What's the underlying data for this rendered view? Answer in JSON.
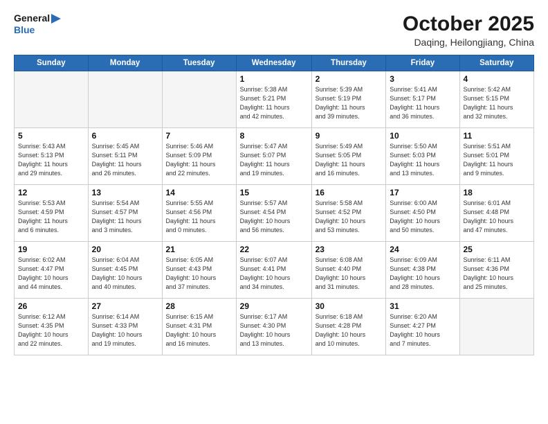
{
  "logo": {
    "line1": "General",
    "line2": "Blue"
  },
  "title": "October 2025",
  "location": "Daqing, Heilongjiang, China",
  "weekdays": [
    "Sunday",
    "Monday",
    "Tuesday",
    "Wednesday",
    "Thursday",
    "Friday",
    "Saturday"
  ],
  "weeks": [
    [
      {
        "day": "",
        "info": ""
      },
      {
        "day": "",
        "info": ""
      },
      {
        "day": "",
        "info": ""
      },
      {
        "day": "1",
        "info": "Sunrise: 5:38 AM\nSunset: 5:21 PM\nDaylight: 11 hours\nand 42 minutes."
      },
      {
        "day": "2",
        "info": "Sunrise: 5:39 AM\nSunset: 5:19 PM\nDaylight: 11 hours\nand 39 minutes."
      },
      {
        "day": "3",
        "info": "Sunrise: 5:41 AM\nSunset: 5:17 PM\nDaylight: 11 hours\nand 36 minutes."
      },
      {
        "day": "4",
        "info": "Sunrise: 5:42 AM\nSunset: 5:15 PM\nDaylight: 11 hours\nand 32 minutes."
      }
    ],
    [
      {
        "day": "5",
        "info": "Sunrise: 5:43 AM\nSunset: 5:13 PM\nDaylight: 11 hours\nand 29 minutes."
      },
      {
        "day": "6",
        "info": "Sunrise: 5:45 AM\nSunset: 5:11 PM\nDaylight: 11 hours\nand 26 minutes."
      },
      {
        "day": "7",
        "info": "Sunrise: 5:46 AM\nSunset: 5:09 PM\nDaylight: 11 hours\nand 22 minutes."
      },
      {
        "day": "8",
        "info": "Sunrise: 5:47 AM\nSunset: 5:07 PM\nDaylight: 11 hours\nand 19 minutes."
      },
      {
        "day": "9",
        "info": "Sunrise: 5:49 AM\nSunset: 5:05 PM\nDaylight: 11 hours\nand 16 minutes."
      },
      {
        "day": "10",
        "info": "Sunrise: 5:50 AM\nSunset: 5:03 PM\nDaylight: 11 hours\nand 13 minutes."
      },
      {
        "day": "11",
        "info": "Sunrise: 5:51 AM\nSunset: 5:01 PM\nDaylight: 11 hours\nand 9 minutes."
      }
    ],
    [
      {
        "day": "12",
        "info": "Sunrise: 5:53 AM\nSunset: 4:59 PM\nDaylight: 11 hours\nand 6 minutes."
      },
      {
        "day": "13",
        "info": "Sunrise: 5:54 AM\nSunset: 4:57 PM\nDaylight: 11 hours\nand 3 minutes."
      },
      {
        "day": "14",
        "info": "Sunrise: 5:55 AM\nSunset: 4:56 PM\nDaylight: 11 hours\nand 0 minutes."
      },
      {
        "day": "15",
        "info": "Sunrise: 5:57 AM\nSunset: 4:54 PM\nDaylight: 10 hours\nand 56 minutes."
      },
      {
        "day": "16",
        "info": "Sunrise: 5:58 AM\nSunset: 4:52 PM\nDaylight: 10 hours\nand 53 minutes."
      },
      {
        "day": "17",
        "info": "Sunrise: 6:00 AM\nSunset: 4:50 PM\nDaylight: 10 hours\nand 50 minutes."
      },
      {
        "day": "18",
        "info": "Sunrise: 6:01 AM\nSunset: 4:48 PM\nDaylight: 10 hours\nand 47 minutes."
      }
    ],
    [
      {
        "day": "19",
        "info": "Sunrise: 6:02 AM\nSunset: 4:47 PM\nDaylight: 10 hours\nand 44 minutes."
      },
      {
        "day": "20",
        "info": "Sunrise: 6:04 AM\nSunset: 4:45 PM\nDaylight: 10 hours\nand 40 minutes."
      },
      {
        "day": "21",
        "info": "Sunrise: 6:05 AM\nSunset: 4:43 PM\nDaylight: 10 hours\nand 37 minutes."
      },
      {
        "day": "22",
        "info": "Sunrise: 6:07 AM\nSunset: 4:41 PM\nDaylight: 10 hours\nand 34 minutes."
      },
      {
        "day": "23",
        "info": "Sunrise: 6:08 AM\nSunset: 4:40 PM\nDaylight: 10 hours\nand 31 minutes."
      },
      {
        "day": "24",
        "info": "Sunrise: 6:09 AM\nSunset: 4:38 PM\nDaylight: 10 hours\nand 28 minutes."
      },
      {
        "day": "25",
        "info": "Sunrise: 6:11 AM\nSunset: 4:36 PM\nDaylight: 10 hours\nand 25 minutes."
      }
    ],
    [
      {
        "day": "26",
        "info": "Sunrise: 6:12 AM\nSunset: 4:35 PM\nDaylight: 10 hours\nand 22 minutes."
      },
      {
        "day": "27",
        "info": "Sunrise: 6:14 AM\nSunset: 4:33 PM\nDaylight: 10 hours\nand 19 minutes."
      },
      {
        "day": "28",
        "info": "Sunrise: 6:15 AM\nSunset: 4:31 PM\nDaylight: 10 hours\nand 16 minutes."
      },
      {
        "day": "29",
        "info": "Sunrise: 6:17 AM\nSunset: 4:30 PM\nDaylight: 10 hours\nand 13 minutes."
      },
      {
        "day": "30",
        "info": "Sunrise: 6:18 AM\nSunset: 4:28 PM\nDaylight: 10 hours\nand 10 minutes."
      },
      {
        "day": "31",
        "info": "Sunrise: 6:20 AM\nSunset: 4:27 PM\nDaylight: 10 hours\nand 7 minutes."
      },
      {
        "day": "",
        "info": ""
      }
    ]
  ]
}
